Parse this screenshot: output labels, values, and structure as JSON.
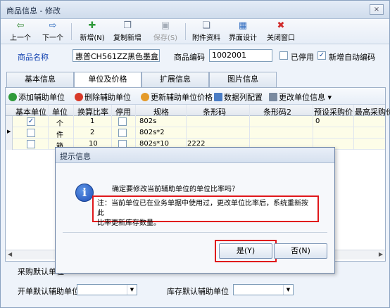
{
  "window": {
    "title": "商品信息 - 修改",
    "close_label": "×"
  },
  "toolbar": {
    "items": [
      {
        "label": "上一个",
        "icon": "arrow-left-icon",
        "glyph": "⇦"
      },
      {
        "label": "下一个",
        "icon": "arrow-right-icon",
        "glyph": "⇨"
      },
      {
        "label": "新增(N)",
        "icon": "add-icon",
        "glyph": "✚"
      },
      {
        "label": "复制新增",
        "icon": "copy-icon",
        "glyph": "❐"
      },
      {
        "label": "保存(S)",
        "icon": "save-icon",
        "glyph": "▣"
      },
      {
        "label": "附件资料",
        "icon": "attachment-icon",
        "glyph": "❏"
      },
      {
        "label": "界面设计",
        "icon": "layout-icon",
        "glyph": "▦"
      },
      {
        "label": "关闭窗口",
        "icon": "close-window-icon",
        "glyph": "✖"
      }
    ]
  },
  "form": {
    "name_label": "商品名称",
    "name_value": "惠普CH561ZZ黑色墨盒",
    "code_label": "商品编码",
    "code_value": "1002001",
    "disabled_label": "已停用",
    "auto_code_label": "新增自动编码"
  },
  "tabs": [
    "基本信息",
    "单位及价格",
    "扩展信息",
    "图片信息"
  ],
  "subtoolbar": {
    "add": "添加辅助单位",
    "delete": "删除辅助单位",
    "update_price": "更新辅助单位价格",
    "column_config": "数据列配置",
    "change_unit": "更改单位信息"
  },
  "grid": {
    "headers": [
      "基本单位",
      "单位",
      "换算比率",
      "停用",
      "规格",
      "条形码",
      "条形码2",
      "预设采购价",
      "最高采购价"
    ],
    "rows": [
      {
        "base": true,
        "unit": "个",
        "ratio": "1",
        "spec": "802s",
        "barcode": "",
        "barcode2": "",
        "price": "0"
      },
      {
        "base": false,
        "unit": "件",
        "ratio": "2",
        "spec": "802s*2",
        "barcode": "",
        "barcode2": "",
        "price": ""
      },
      {
        "base": false,
        "unit": "箱",
        "ratio": "10",
        "spec": "802s*10",
        "barcode": "2222",
        "barcode2": "",
        "price": ""
      }
    ]
  },
  "bottom": {
    "purchase_default": "采购默认单位",
    "billing_default": "开单默认辅助单位",
    "stock_default": "库存默认辅助单位"
  },
  "dialog": {
    "title": "提示信息",
    "question": "确定要修改当前辅助单位的单位比率吗？",
    "note_line1": "注：当前单位已在业务单据中使用过，更改单位比率后，系统重新按此",
    "note_line2": "比率更新库存数量。",
    "yes_label": "是(Y)",
    "no_label": "否(N)"
  },
  "colors": {
    "highlight": "#e0171b",
    "accent": "#1e4fb8"
  }
}
